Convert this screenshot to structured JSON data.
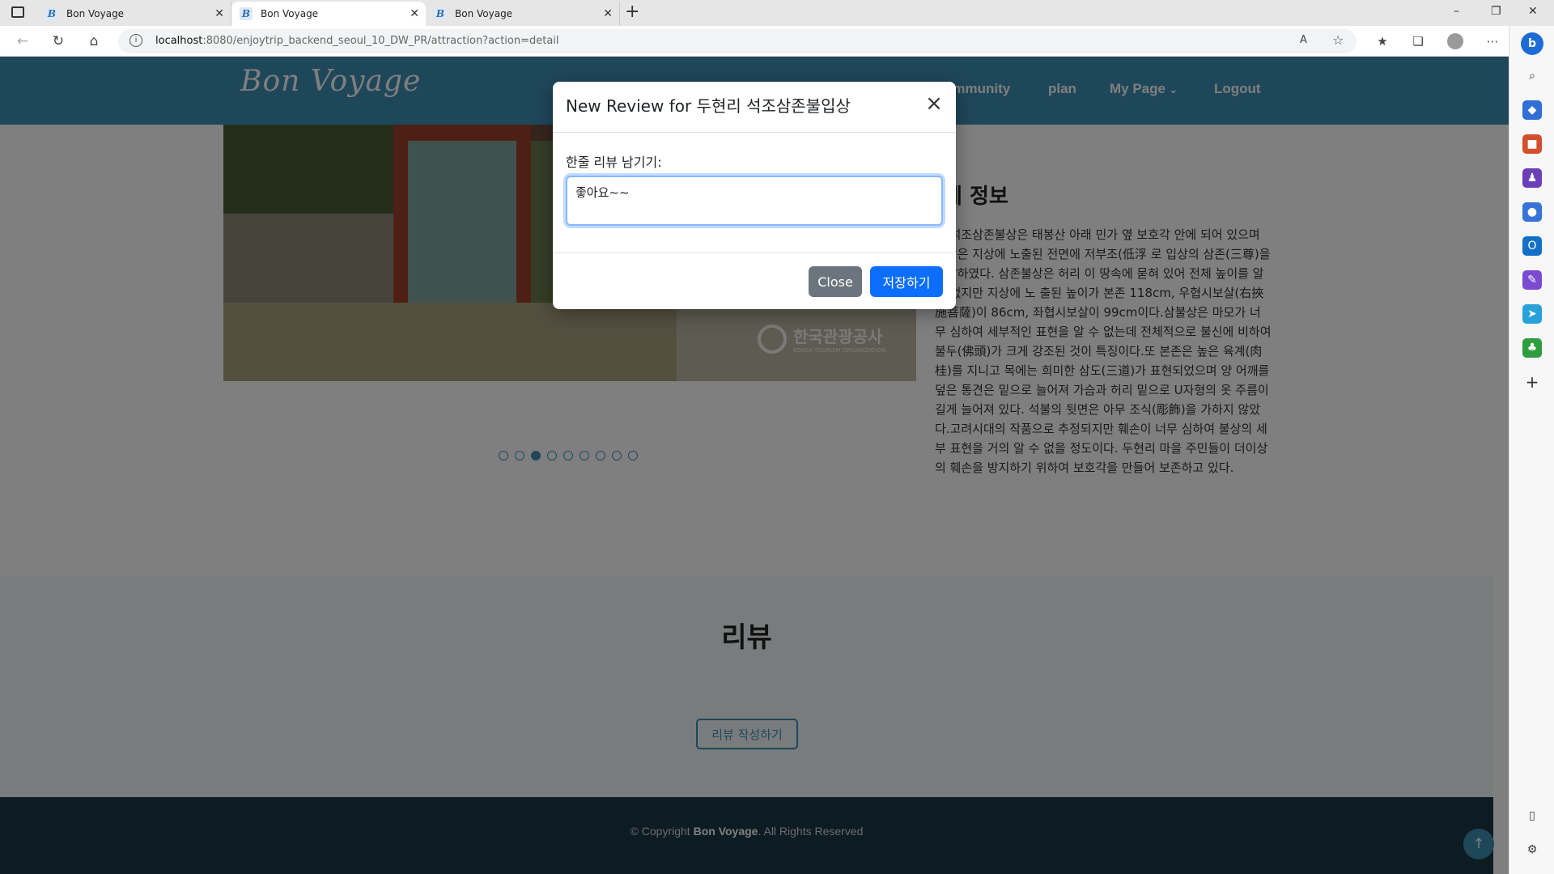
{
  "browser": {
    "tabs": [
      {
        "label": "Bon Voyage",
        "favicon": "B",
        "active": false
      },
      {
        "label": "Bon Voyage",
        "favicon": "B",
        "active": true
      },
      {
        "label": "Bon Voyage",
        "favicon": "B",
        "active": false
      }
    ],
    "new_tab_icon": "+",
    "url_host": "localhost",
    "url_rest": ":8080/enjoytrip_backend_seoul_10_DW_PR/attraction?action=detail",
    "window_controls": [
      "–",
      "❐",
      "✕"
    ]
  },
  "site": {
    "logo": "Bon Voyage",
    "nav": [
      "ommunity",
      "plan",
      "My Page",
      "Logout"
    ],
    "nav_dropdown_icon": "⌄"
  },
  "detail": {
    "title": "세 정보",
    "description": "리 석조삼존불상은 태봉산 아래 민가 옆 보호각 안에 되어 있으며 불상은 지상에 노출된 전면에 저부조(低浮 로 입상의 삼존(三尊)을 조각하였다. 삼존불상은 허리 이 땅속에 묻혀 있어 전체 높이를 알 수 없지만 지상에 노 출된 높이가 본존 118cm, 우협시보살(右挾施菩薩)이 86cm, 좌협시보살이 99cm이다.삼불상은 마모가 너무 심하여 세부적인 표현을 알 수 없는데 전체적으로 불신에 비하여 불두(佛頭)가 크게 강조된 것이 특징이다.또 본존은 높은 육계(肉桂)를 지니고 목에는 희미한 삼도(三道)가 표현되었으며 양 어깨를 덮은 통견은 밑으로 늘어져 가슴과 허리 밑으로 U자형의 옷 주름이 길게 늘어져 있다. 석불의 뒷면은 아무 조식(彫飾)을 가하지 않았다.고려시대의 작품으로 추정되지만 훼손이 너무 심하여 불상의 세부 표현을 거의 알 수 없을 정도이다. 두현리 마을 주민들이 더이상의 훼손을 방지하기 위하여 보호각을 만들어 보존하고 있다."
  },
  "carousel": {
    "count": 9,
    "active_index": 2
  },
  "hero_watermark": "한국관광공사",
  "hero_watermark_sub": "KOREA TOURISM ORGANIZATION",
  "reviews": {
    "title": "리뷰",
    "write_button": "리뷰 작성하기"
  },
  "footer": {
    "prefix": "© Copyright ",
    "brand": "Bon Voyage",
    "suffix": ". All Rights Reserved"
  },
  "modal": {
    "title": "New Review for 두현리 석조삼존불입상",
    "label": "한줄 리뷰 남기기:",
    "input_value": "좋아요~~",
    "close_label": "Close",
    "save_label": "저장하기"
  },
  "colors": {
    "header": "#3f8fb4",
    "footer": "#1a3946",
    "primary_button": "#0d6efd",
    "secondary_button": "#6c757d"
  }
}
